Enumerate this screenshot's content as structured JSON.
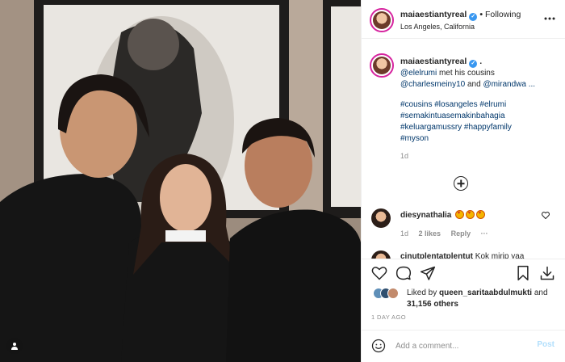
{
  "post": {
    "username": "maiaestiantyreal",
    "verified": true,
    "separator": "•",
    "follow_state": "Following",
    "location": "Los Angeles, California",
    "more_icon": "ellipsis-icon",
    "dots": "•••"
  },
  "caption": {
    "username": "maiaestiantyreal",
    "trailing": ".",
    "line1_mention": "@elelrumi",
    "line1_text": " met his cousins",
    "line2_mention_a": "@charlesmeiny10",
    "line2_and": " and ",
    "line2_mention_b": "@mirandwa ...",
    "hashtags": [
      "#cousins #losangeles #elrumi",
      "#semakintuasemakinbahagia",
      "#keluargamussry #happyfamily",
      "#myson"
    ],
    "age": "1d"
  },
  "comments": [
    {
      "username": "diesynathalia",
      "emoji_count": 3,
      "age": "1d",
      "likes": "2 likes",
      "reply": "Reply",
      "more": "···"
    },
    {
      "username_partial": "cinutplentatplentut",
      "text_partial": "Kok mirip yaa"
    }
  ],
  "likes": {
    "prefix": "Liked by",
    "user": "queen_saritaabdulmukti",
    "and": " and",
    "count": "31,156 others"
  },
  "time_ago": "1 DAY AGO",
  "composer": {
    "placeholder": "Add a comment...",
    "post_label": "Post"
  },
  "colors": {
    "link": "#00376b",
    "verified": "#3897f0",
    "muted": "#8e8e8e",
    "post_disabled": "#b2dffc"
  }
}
